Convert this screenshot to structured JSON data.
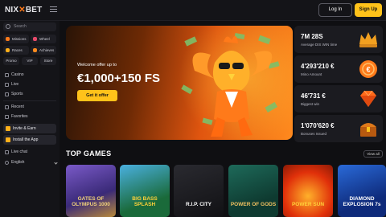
{
  "header": {
    "logo_prefix": "NIX",
    "logo_x": "✕",
    "logo_suffix": "BET",
    "login_label": "Log In",
    "signup_label": "Sign Up"
  },
  "sidebar": {
    "search_placeholder": "Search",
    "chips": [
      {
        "label": "Missions",
        "color": "#ff7a1a"
      },
      {
        "label": "Wheel",
        "color": "#e84a6a"
      },
      {
        "label": "Races",
        "color": "#ffb01a"
      },
      {
        "label": "Achieves",
        "color": "#ff8a1e"
      }
    ],
    "chips3": [
      "Promo",
      "VIP",
      "Store"
    ],
    "nav": [
      "Casino",
      "Live",
      "Sports",
      "Recent",
      "Favorites"
    ],
    "promos": [
      "Invite & Earn",
      "Install the App"
    ],
    "live_chat": "Live chat",
    "language": "English"
  },
  "hero": {
    "subtitle": "Welcome offer up to",
    "amount": "€1,000+150 FS",
    "cta": "Get it offer"
  },
  "stats": [
    {
      "value": "7M 28S",
      "label": "Average DIS WIN time"
    },
    {
      "value": "4'293'210 €",
      "label": "Mino Amount"
    },
    {
      "value": "46'731 €",
      "label": "Biggest win"
    },
    {
      "value": "1'070'620 €",
      "label": "Bonuses Issued"
    }
  ],
  "top_games": {
    "title": "TOP GAMES",
    "view_all": "View all",
    "games": [
      {
        "name": "GATES OF OLYMPUS 1000",
        "color": "#f2d27a"
      },
      {
        "name": "BIG BASS SPLASH",
        "color": "#ffd23a"
      },
      {
        "name": "R.I.P. CITY",
        "color": "#ffffff"
      },
      {
        "name": "POWER OF GODS",
        "color": "#f0c060"
      },
      {
        "name": "POWER SUN",
        "color": "#ffd23a"
      },
      {
        "name": "DIAMOND EXPLOSION 7s",
        "color": "#ffffff"
      }
    ]
  }
}
